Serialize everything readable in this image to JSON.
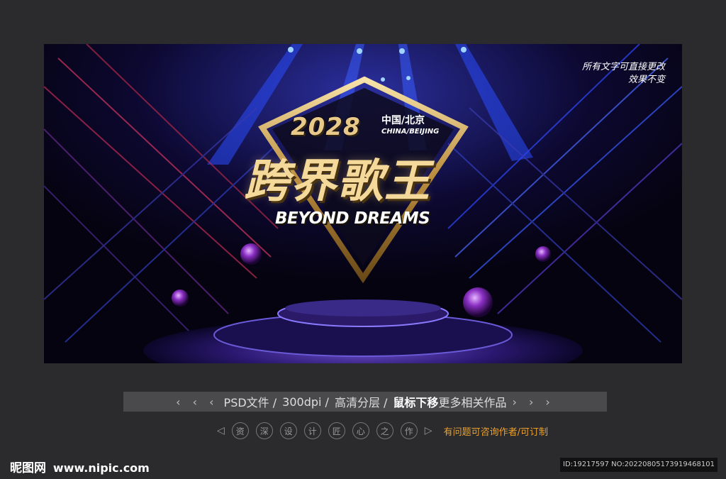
{
  "banner": {
    "note_line1": "所有文字可直接更改",
    "note_line2": "效果不变",
    "year": "2028",
    "location_cn": "中国/北京",
    "location_en": "CHINA/BEIJING",
    "title_cn": "跨界歌王",
    "title_en": "BEYOND DREAMS"
  },
  "info_bar": {
    "left_arrows": "‹ ‹ ‹",
    "item1": "PSD文件 /",
    "item2": "300dpi /",
    "item3": "高清分层 /",
    "item4_bold": "鼠标下移",
    "item4_rest": "更多相关作品",
    "right_arrows": "› › ›"
  },
  "designer": {
    "prev_arrow": "◁",
    "chars": [
      "资",
      "深",
      "设",
      "计",
      "匠",
      "心",
      "之",
      "作"
    ],
    "next_arrow": "▷",
    "custom_text": "有问题可咨询作者/可订制"
  },
  "footer": {
    "logo_text": "昵图网",
    "logo_url": "www.nipic.com",
    "id_text": "ID:19217597 NO:20220805173919468101"
  }
}
